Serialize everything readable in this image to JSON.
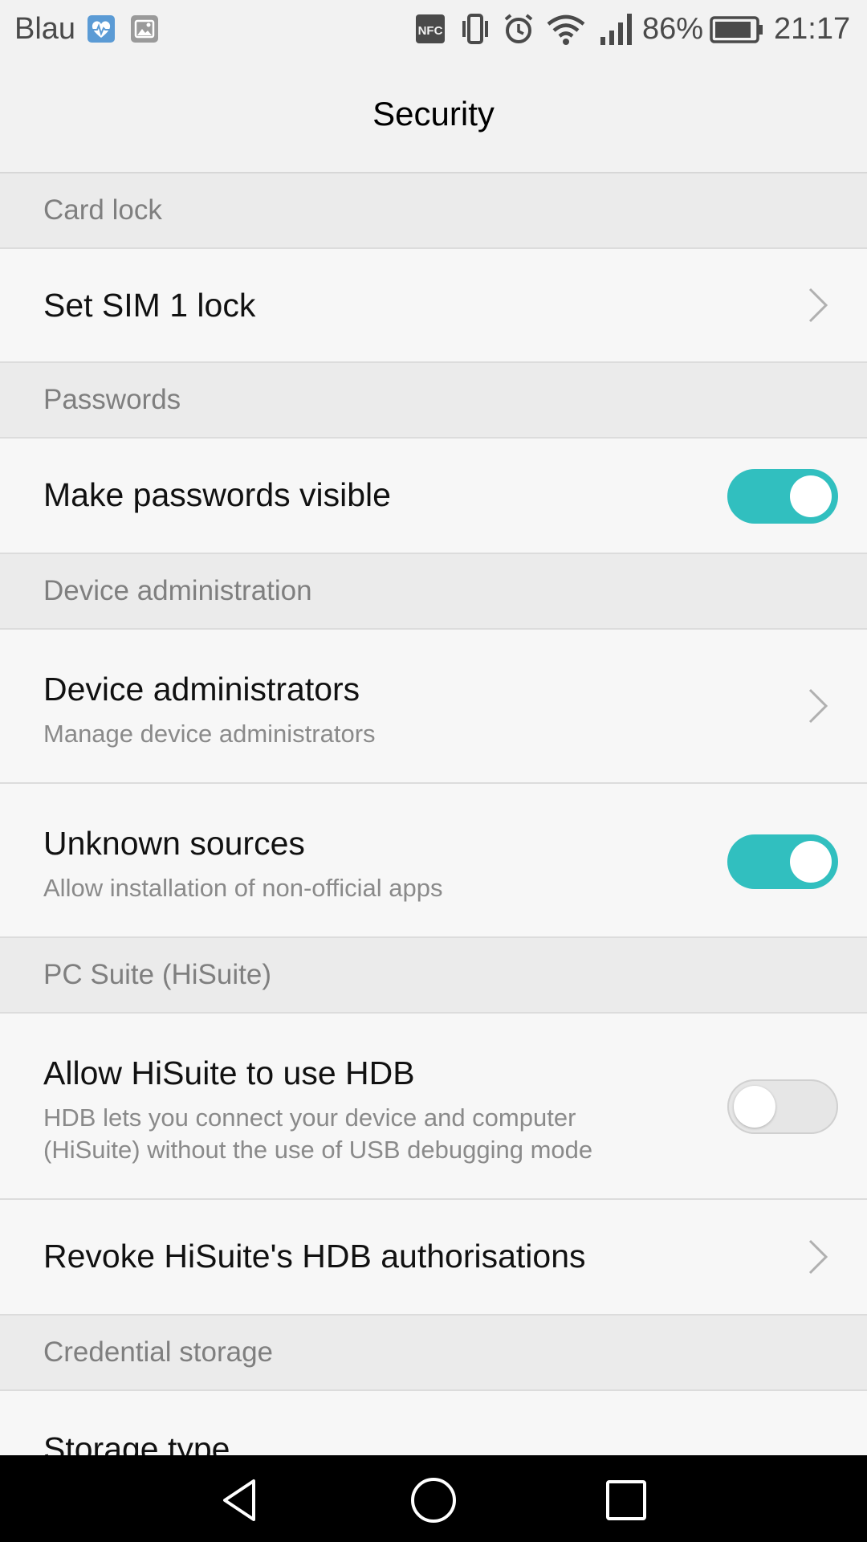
{
  "status_bar": {
    "carrier": "Blau",
    "notification_icons": [
      "health-app-icon",
      "gallery-icon"
    ],
    "system_icons": [
      "nfc-icon",
      "vibrate-icon",
      "alarm-icon",
      "wifi-icon",
      "signal-icon",
      "battery-icon"
    ],
    "battery_percent": "86%",
    "time": "21:17"
  },
  "header": {
    "title": "Security"
  },
  "sections": {
    "card_lock": {
      "header": "Card lock",
      "set_sim_lock": {
        "title": "Set SIM 1 lock"
      }
    },
    "passwords": {
      "header": "Passwords",
      "make_visible": {
        "title": "Make passwords visible",
        "enabled": true
      }
    },
    "device_administration": {
      "header": "Device administration",
      "device_admins": {
        "title": "Device administrators",
        "subtitle": "Manage device administrators"
      },
      "unknown_sources": {
        "title": "Unknown sources",
        "subtitle": "Allow installation of non-official apps",
        "enabled": true
      }
    },
    "pc_suite": {
      "header": "PC Suite (HiSuite)",
      "allow_hdb": {
        "title": "Allow HiSuite to use HDB",
        "subtitle": "HDB lets you connect your device and computer (HiSuite) without the use of USB debugging mode",
        "enabled": false
      },
      "revoke_hdb": {
        "title": "Revoke HiSuite's HDB authorisations"
      }
    },
    "credential_storage": {
      "header": "Credential storage",
      "storage_type": {
        "title": "Storage type"
      }
    }
  },
  "colors": {
    "toggle_on": "#31bfbf",
    "toggle_off": "#e6e6e6",
    "section_header_bg": "#ebebeb",
    "row_bg": "#f7f7f7"
  },
  "nav_bar": {
    "buttons": [
      "back-icon",
      "home-icon",
      "recents-icon"
    ]
  }
}
